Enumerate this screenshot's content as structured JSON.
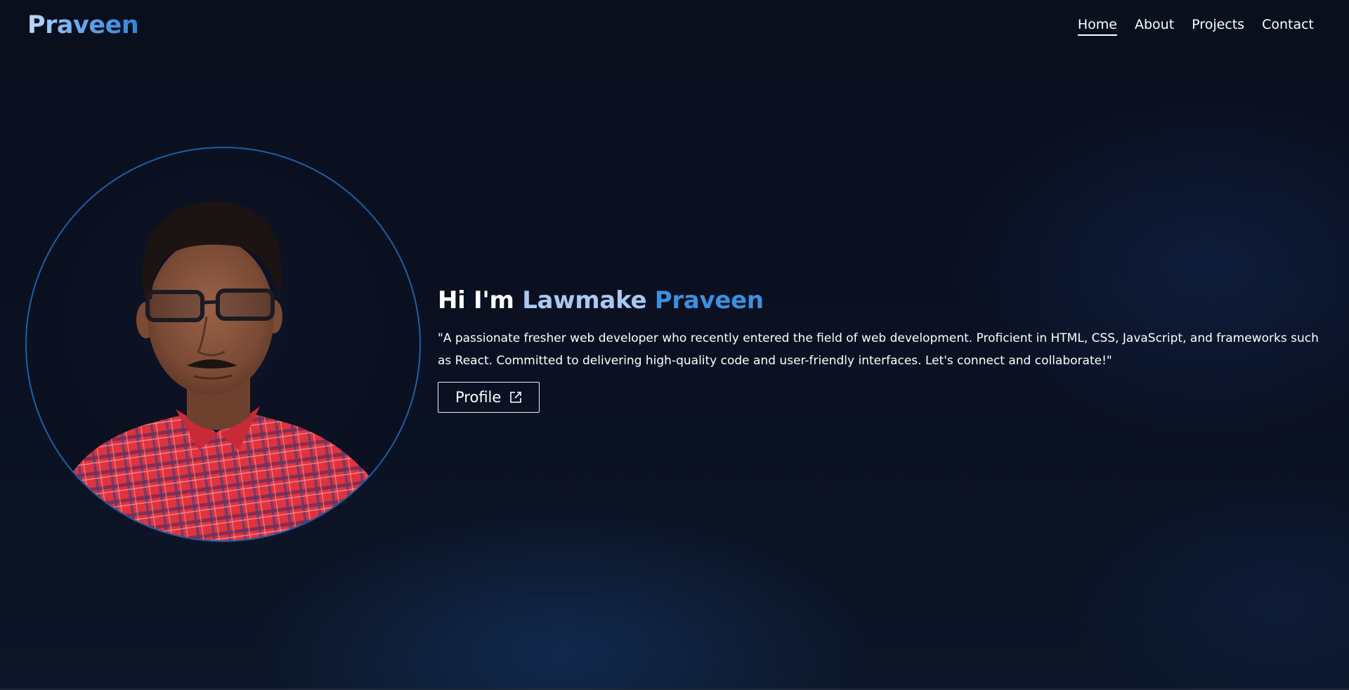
{
  "header": {
    "logo": "Praveen",
    "nav": [
      {
        "label": "Home",
        "active": true
      },
      {
        "label": "About",
        "active": false
      },
      {
        "label": "Projects",
        "active": false
      },
      {
        "label": "Contact",
        "active": false
      }
    ]
  },
  "hero": {
    "greeting": "Hi I'm",
    "first_name": "Lawmake",
    "last_name": "Praveen",
    "description": "\"A passionate fresher web developer who recently entered the field of web development. Proficient in HTML, CSS, JavaScript, and frameworks such as React. Committed to delivering high-quality code and user-friendly interfaces. Let's connect and collaborate!\"",
    "profile_button": "Profile",
    "profile_icon": "external-link-icon"
  },
  "portrait": {
    "icon": "profile-photo",
    "ring_color": "#1d5fa8"
  },
  "colors": {
    "background": "#0a0f1e",
    "accent": "#3d8fe0",
    "accent_light": "#a9c9f2"
  }
}
